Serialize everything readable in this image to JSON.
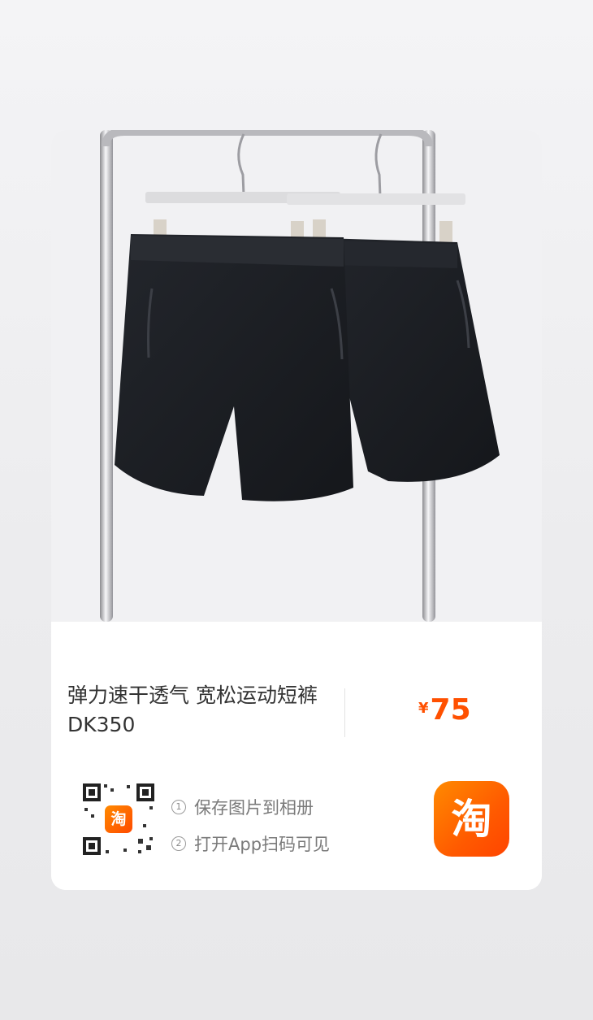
{
  "product": {
    "title": "弹力速干透气 宽松运动短裤 DK350",
    "price_currency": "¥",
    "price_value": "75"
  },
  "share": {
    "qr_badge_char": "淘",
    "steps": [
      {
        "num": "1",
        "text": "保存图片到相册"
      },
      {
        "num": "2",
        "text": "打开App扫码可见"
      }
    ],
    "app_icon_char": "淘"
  },
  "colors": {
    "accent": "#ff5000",
    "app_icon_gradient_start": "#ff8a00",
    "app_icon_gradient_end": "#ff4400",
    "shorts": "#1b1d22"
  },
  "icons": {
    "qr_code": "qr-code-icon",
    "app": "taobao-app-icon"
  }
}
